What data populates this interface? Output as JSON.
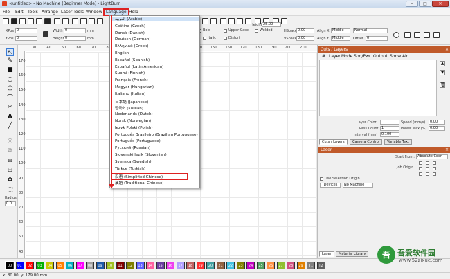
{
  "window": {
    "title": "<untitled> - No Machine (Beginner Mode) - LightBurn",
    "minimize": "–",
    "maximize": "□",
    "close": "✕"
  },
  "menu": [
    "File",
    "Edit",
    "Tools",
    "Arrange",
    "Laser Tools",
    "Window",
    "Language",
    "Help"
  ],
  "toolbar2": {
    "xpos": "XPos",
    "ypos": "YPos",
    "xpos_value": "0",
    "ypos_value": "0",
    "width": "Width",
    "height": "Height",
    "width_value": "0",
    "height_value": "0",
    "unit": "mm",
    "upper_case": "Upper Case",
    "bold": "Bold",
    "italic": "Italic",
    "distort": "Distort",
    "welded": "Welded",
    "font_height": "Height",
    "font_height_value": "25.00",
    "hspace": "HSpace",
    "vspace": "VSpace",
    "hspace_value": "0.00",
    "vspace_value": "0.00",
    "align_x": "Align X",
    "align_y": "Align Y",
    "align_x_value": "Middle",
    "align_y_value": "Middle",
    "normal": "Normal",
    "offset": "Offset",
    "offset_value": "0"
  },
  "ruler": {
    "top": [
      "30",
      "40",
      "50",
      "60",
      "70",
      "80",
      "90",
      "100",
      "110",
      "120",
      "130",
      "140",
      "150",
      "160",
      "170",
      "180",
      "190",
      "200",
      "210"
    ],
    "left": [
      "170",
      "160",
      "150",
      "140",
      "130",
      "120",
      "110",
      "100",
      "90",
      "80",
      "70",
      "60",
      "50",
      "40"
    ]
  },
  "language_menu": {
    "items": [
      "العربية (Arabic)",
      "Čeština (Czech)",
      "Dansk (Danish)",
      "Deutsch (German)",
      "Ελληνικά (Greek)",
      "English",
      "Español (Spanish)",
      "Español (Latin American)",
      "Suomi (Finnish)",
      "Français (French)",
      "Magyar (Hungarian)",
      "Italiano (Italian)",
      "日本語 (Japanese)",
      "한국어 (Korean)",
      "Nederlands (Dutch)",
      "Norsk (Norwegian)",
      "Język Polski (Polish)",
      "Português Brasileiro (Brazilian Portuguese)",
      "Português (Portuguese)",
      "Русский (Russian)",
      "Slovenski Jezik (Slovenian)",
      "Svenska (Swedish)",
      "Türkçe (Turkish)",
      "汉语 (Simplified Chinese)",
      "漢語 (Traditional Chinese)"
    ],
    "highlighted_index": 23
  },
  "cuts_layers": {
    "title": "Cuts / Layers",
    "columns": [
      "#",
      "Layer",
      "Mode",
      "Spd/Pwr",
      "Output",
      "Show",
      "Air"
    ],
    "layer_color": "Layer Color",
    "pass_count": "Pass Count",
    "pass_count_value": "1",
    "interval": "Interval (mm)",
    "interval_value": "0.100",
    "speed": "Speed (mm/s)",
    "speed_value": "0.00",
    "max_power": "Power Max (%)",
    "max_power_value": "0.00",
    "tabs": [
      "Cuts / Layers",
      "Camera Control",
      "Variable Text"
    ]
  },
  "laser_panel": {
    "title": "Laser",
    "start_from": "Start From:",
    "start_from_value": "Absolute Coor",
    "job_origin": "Job Origin",
    "use_selection_origin": "Use Selection Origin",
    "devices": "Devices",
    "device_value": "No Machine",
    "tabs": [
      "Laser",
      "Material Library"
    ]
  },
  "left_tools": {
    "radius_label": "Radius:",
    "radius_value": "0.0"
  },
  "palette": {
    "labels": [
      "00",
      "01",
      "02",
      "03",
      "04",
      "05",
      "06",
      "07",
      "08",
      "09",
      "10",
      "11",
      "12",
      "13",
      "14",
      "15",
      "16",
      "17",
      "18",
      "19",
      "20",
      "21",
      "22",
      "23",
      "24",
      "25",
      "26",
      "27",
      "28",
      "29",
      "T1",
      "T2"
    ],
    "colors": [
      "#000000",
      "#0000ff",
      "#ff0000",
      "#00b000",
      "#c8c800",
      "#ff8000",
      "#00b0c0",
      "#ff00ff",
      "#a0a0a0",
      "#1e5aa8",
      "#a0c020",
      "#7f0000",
      "#7f7f00",
      "#6060ff",
      "#ff60a0",
      "#6a3da0",
      "#f040f0",
      "#b0a0ff",
      "#c06060",
      "#ff3030",
      "#40a0a0",
      "#906040",
      "#40c0e0",
      "#808000",
      "#c000c0",
      "#50a060",
      "#ff9040",
      "#90c030",
      "#d05080",
      "#e08000",
      "#808080",
      "#606060"
    ]
  },
  "status": {
    "coords": "x: 80.00, y: 179.00 mm"
  },
  "watermark": {
    "logo": "吾",
    "text": "吾爱软件园",
    "url": "www.52zixue.com"
  }
}
